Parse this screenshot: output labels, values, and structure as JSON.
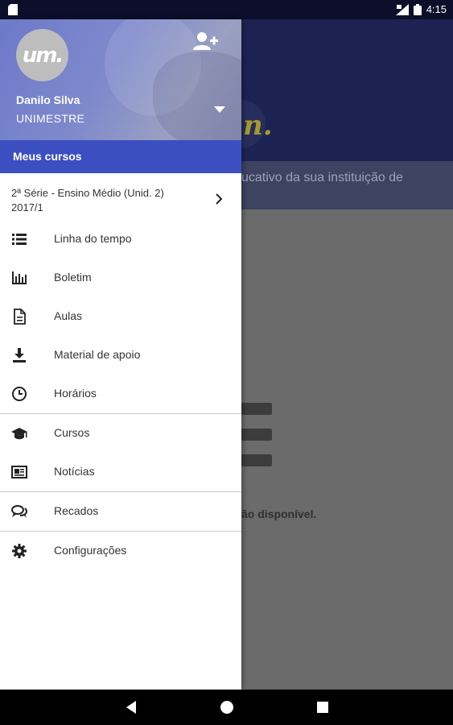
{
  "status_bar": {
    "time": "4:15",
    "icons": [
      "sd-card-icon",
      "signal-icon",
      "battery-icon"
    ]
  },
  "drawer": {
    "avatar_text": "um.",
    "user_name": "Danilo Silva",
    "organization": "UNIMESTRE",
    "section_title": "Meus cursos",
    "section_color": "#3b4fc1",
    "course": {
      "line1": "2ª Série - Ensino Médio (Unid. 2)",
      "line2": "2017/1"
    },
    "menu": [
      {
        "label": "Linha do tempo",
        "icon": "list-icon"
      },
      {
        "label": "Boletim",
        "icon": "bar-chart-icon"
      },
      {
        "label": "Aulas",
        "icon": "document-icon"
      },
      {
        "label": "Material de apoio",
        "icon": "download-icon"
      },
      {
        "label": "Horários",
        "icon": "clock-icon"
      },
      {
        "label": "Cursos",
        "icon": "graduation-cap-icon"
      },
      {
        "label": "Notícias",
        "icon": "news-icon"
      },
      {
        "label": "Recados",
        "icon": "chat-icon"
      },
      {
        "label": "Configurações",
        "icon": "gear-icon"
      }
    ]
  },
  "background_app": {
    "logo_fragment": "n.",
    "band_text": "ucativo da sua instituição de",
    "message_fragment": "ão disponível."
  }
}
